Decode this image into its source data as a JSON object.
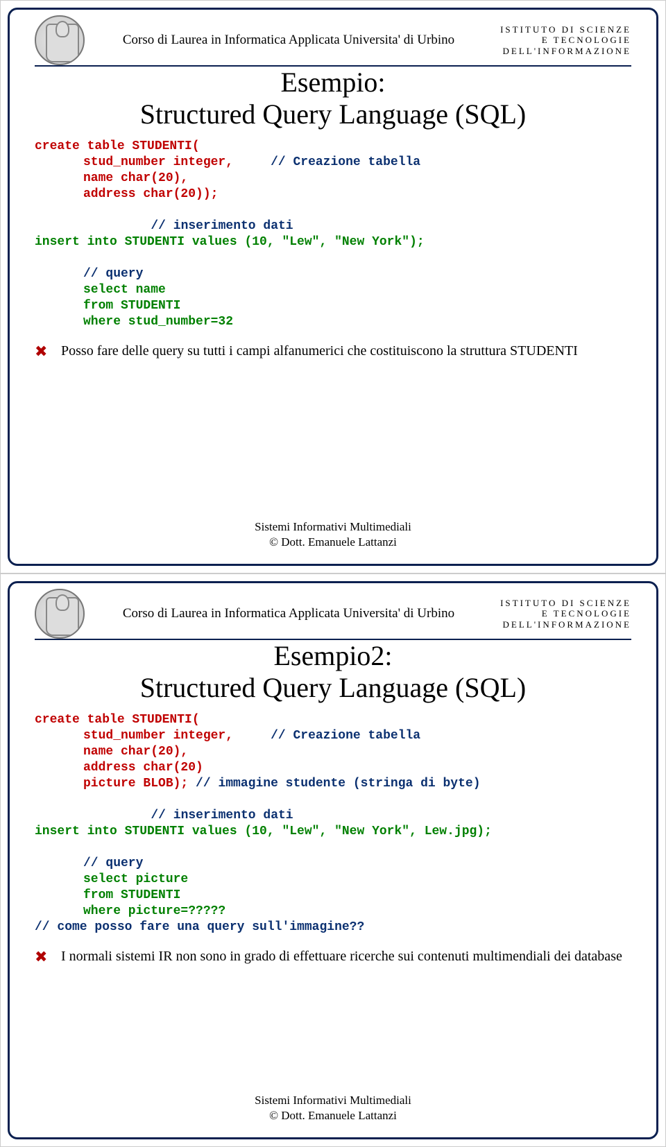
{
  "header": {
    "course": "Corso di Laurea in Informatica Applicata Universita' di Urbino",
    "instituto_l1": "ISTITUTO DI SCIENZE",
    "instituto_l2": "E TECNOLOGIE",
    "instituto_l3": "DELL'INFORMAZIONE"
  },
  "slide1": {
    "title_l1": "Esempio:",
    "title_l2": "Structured Query Language (SQL)",
    "code": {
      "l1": "create table STUDENTI(",
      "l2a": "stud_number integer,",
      "l2b": "// Creazione tabella",
      "l3": "name char(20),",
      "l4": "address char(20));",
      "l5": "// inserimento dati",
      "l6": "insert into STUDENTI values (10, \"Lew\", \"New York\");",
      "l7": "// query",
      "l8": "select name",
      "l9": "from STUDENTI",
      "l10": "where stud_number=32"
    },
    "bullet": "Posso fare delle query su tutti i campi alfanumerici che costituiscono la struttura STUDENTI"
  },
  "slide2": {
    "title_l1": "Esempio2:",
    "title_l2": "Structured Query Language (SQL)",
    "code": {
      "l1": "create table STUDENTI(",
      "l2a": "stud_number integer,",
      "l2b": "// Creazione tabella",
      "l3": "name char(20),",
      "l4": "address char(20)",
      "l5a": "picture BLOB);",
      "l5b": "// immagine studente (stringa di byte)",
      "l6": "// inserimento dati",
      "l7": "insert into STUDENTI values (10, \"Lew\", \"New York\", Lew.jpg);",
      "l8": "// query",
      "l9": "select picture",
      "l10": "from STUDENTI",
      "l11": "where picture=?????",
      "l12": "// come posso fare una query sull'immagine??"
    },
    "bullet": "I normali sistemi IR non sono in grado di effettuare ricerche sui contenuti multimendiali dei database"
  },
  "footer": {
    "l1": "Sistemi Informativi Multimediali",
    "l2": "© Dott. Emanuele Lattanzi"
  }
}
